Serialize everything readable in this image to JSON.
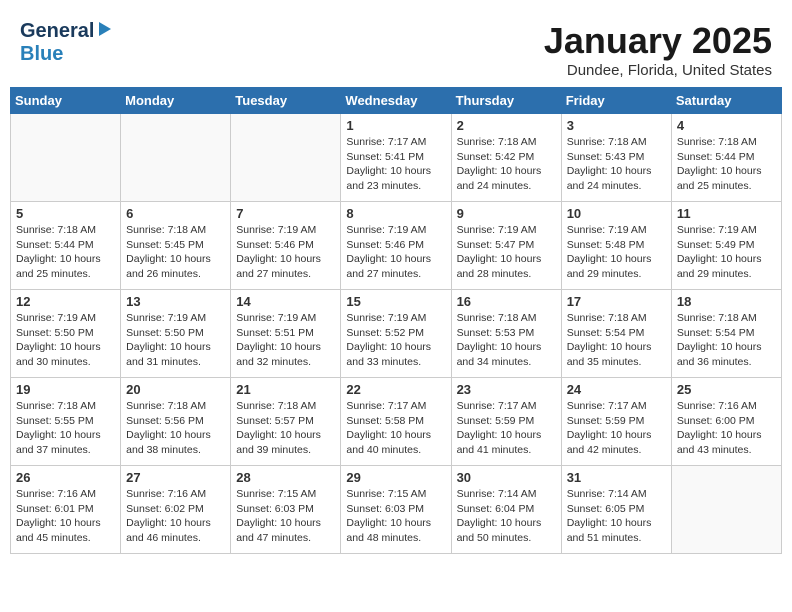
{
  "header": {
    "logo_general": "General",
    "logo_blue": "Blue",
    "title": "January 2025",
    "location": "Dundee, Florida, United States"
  },
  "days_of_week": [
    "Sunday",
    "Monday",
    "Tuesday",
    "Wednesday",
    "Thursday",
    "Friday",
    "Saturday"
  ],
  "weeks": [
    [
      {
        "day": "",
        "empty": true
      },
      {
        "day": "",
        "empty": true
      },
      {
        "day": "",
        "empty": true
      },
      {
        "day": "1",
        "sunrise": "7:17 AM",
        "sunset": "5:41 PM",
        "daylight": "10 hours and 23 minutes."
      },
      {
        "day": "2",
        "sunrise": "7:18 AM",
        "sunset": "5:42 PM",
        "daylight": "10 hours and 24 minutes."
      },
      {
        "day": "3",
        "sunrise": "7:18 AM",
        "sunset": "5:43 PM",
        "daylight": "10 hours and 24 minutes."
      },
      {
        "day": "4",
        "sunrise": "7:18 AM",
        "sunset": "5:44 PM",
        "daylight": "10 hours and 25 minutes."
      }
    ],
    [
      {
        "day": "5",
        "sunrise": "7:18 AM",
        "sunset": "5:44 PM",
        "daylight": "10 hours and 25 minutes."
      },
      {
        "day": "6",
        "sunrise": "7:18 AM",
        "sunset": "5:45 PM",
        "daylight": "10 hours and 26 minutes."
      },
      {
        "day": "7",
        "sunrise": "7:19 AM",
        "sunset": "5:46 PM",
        "daylight": "10 hours and 27 minutes."
      },
      {
        "day": "8",
        "sunrise": "7:19 AM",
        "sunset": "5:46 PM",
        "daylight": "10 hours and 27 minutes."
      },
      {
        "day": "9",
        "sunrise": "7:19 AM",
        "sunset": "5:47 PM",
        "daylight": "10 hours and 28 minutes."
      },
      {
        "day": "10",
        "sunrise": "7:19 AM",
        "sunset": "5:48 PM",
        "daylight": "10 hours and 29 minutes."
      },
      {
        "day": "11",
        "sunrise": "7:19 AM",
        "sunset": "5:49 PM",
        "daylight": "10 hours and 29 minutes."
      }
    ],
    [
      {
        "day": "12",
        "sunrise": "7:19 AM",
        "sunset": "5:50 PM",
        "daylight": "10 hours and 30 minutes."
      },
      {
        "day": "13",
        "sunrise": "7:19 AM",
        "sunset": "5:50 PM",
        "daylight": "10 hours and 31 minutes."
      },
      {
        "day": "14",
        "sunrise": "7:19 AM",
        "sunset": "5:51 PM",
        "daylight": "10 hours and 32 minutes."
      },
      {
        "day": "15",
        "sunrise": "7:19 AM",
        "sunset": "5:52 PM",
        "daylight": "10 hours and 33 minutes."
      },
      {
        "day": "16",
        "sunrise": "7:18 AM",
        "sunset": "5:53 PM",
        "daylight": "10 hours and 34 minutes."
      },
      {
        "day": "17",
        "sunrise": "7:18 AM",
        "sunset": "5:54 PM",
        "daylight": "10 hours and 35 minutes."
      },
      {
        "day": "18",
        "sunrise": "7:18 AM",
        "sunset": "5:54 PM",
        "daylight": "10 hours and 36 minutes."
      }
    ],
    [
      {
        "day": "19",
        "sunrise": "7:18 AM",
        "sunset": "5:55 PM",
        "daylight": "10 hours and 37 minutes."
      },
      {
        "day": "20",
        "sunrise": "7:18 AM",
        "sunset": "5:56 PM",
        "daylight": "10 hours and 38 minutes."
      },
      {
        "day": "21",
        "sunrise": "7:18 AM",
        "sunset": "5:57 PM",
        "daylight": "10 hours and 39 minutes."
      },
      {
        "day": "22",
        "sunrise": "7:17 AM",
        "sunset": "5:58 PM",
        "daylight": "10 hours and 40 minutes."
      },
      {
        "day": "23",
        "sunrise": "7:17 AM",
        "sunset": "5:59 PM",
        "daylight": "10 hours and 41 minutes."
      },
      {
        "day": "24",
        "sunrise": "7:17 AM",
        "sunset": "5:59 PM",
        "daylight": "10 hours and 42 minutes."
      },
      {
        "day": "25",
        "sunrise": "7:16 AM",
        "sunset": "6:00 PM",
        "daylight": "10 hours and 43 minutes."
      }
    ],
    [
      {
        "day": "26",
        "sunrise": "7:16 AM",
        "sunset": "6:01 PM",
        "daylight": "10 hours and 45 minutes."
      },
      {
        "day": "27",
        "sunrise": "7:16 AM",
        "sunset": "6:02 PM",
        "daylight": "10 hours and 46 minutes."
      },
      {
        "day": "28",
        "sunrise": "7:15 AM",
        "sunset": "6:03 PM",
        "daylight": "10 hours and 47 minutes."
      },
      {
        "day": "29",
        "sunrise": "7:15 AM",
        "sunset": "6:03 PM",
        "daylight": "10 hours and 48 minutes."
      },
      {
        "day": "30",
        "sunrise": "7:14 AM",
        "sunset": "6:04 PM",
        "daylight": "10 hours and 50 minutes."
      },
      {
        "day": "31",
        "sunrise": "7:14 AM",
        "sunset": "6:05 PM",
        "daylight": "10 hours and 51 minutes."
      },
      {
        "day": "",
        "empty": true
      }
    ]
  ],
  "labels": {
    "sunrise": "Sunrise:",
    "sunset": "Sunset:",
    "daylight": "Daylight:"
  }
}
